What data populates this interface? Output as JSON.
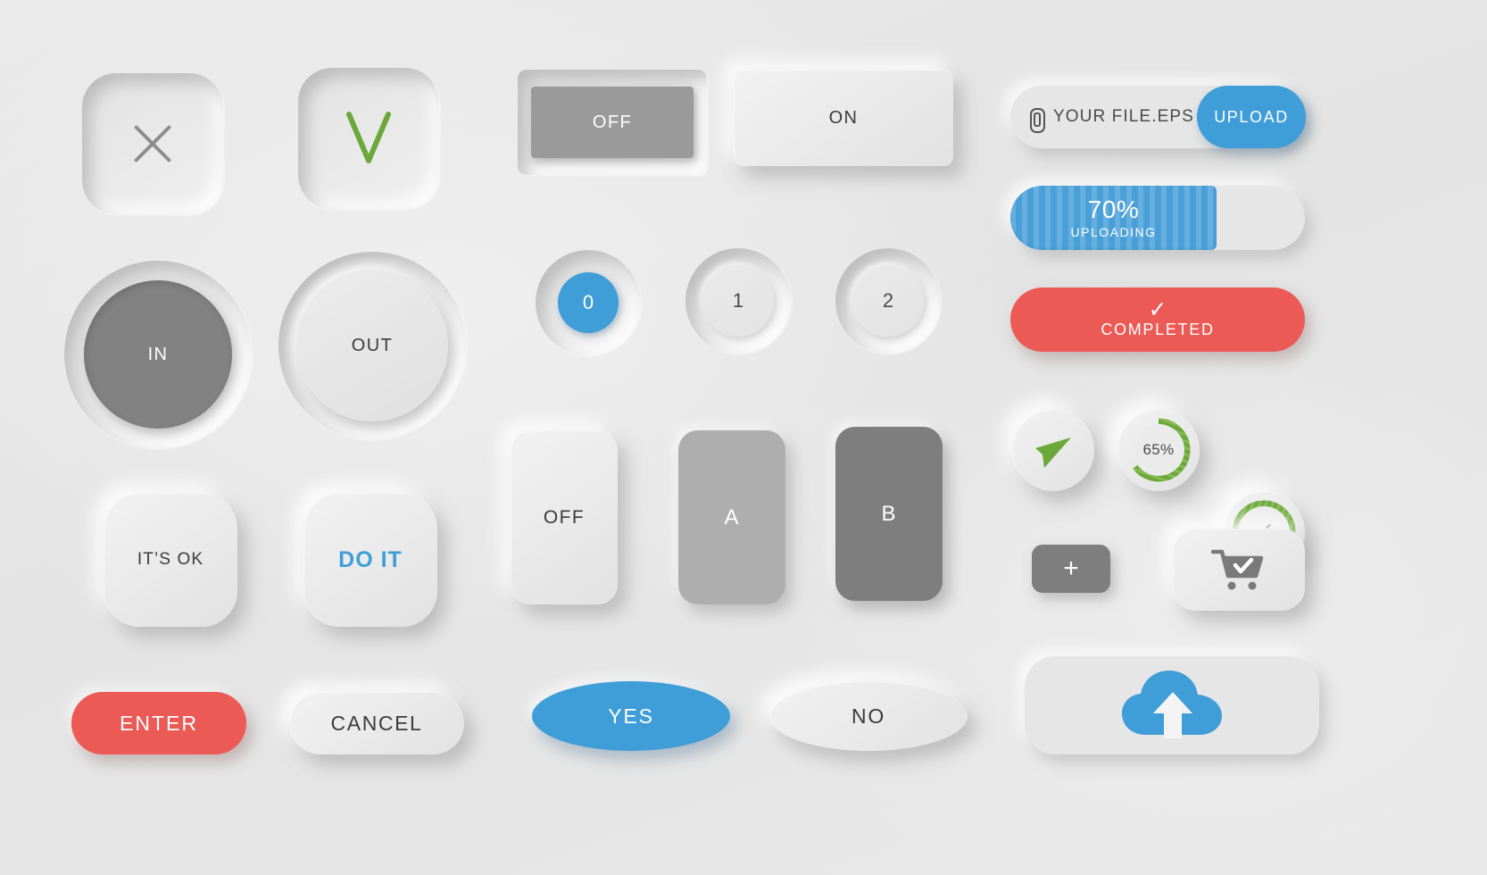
{
  "theme": {
    "background": "#e9e9e9",
    "accent_blue": "#3f9dd8",
    "accent_red": "#ec5a55",
    "accent_green": "#6aa83a",
    "dark_gray": "#7e7e7e",
    "mid_gray": "#aeaeae",
    "text_dark": "#3b3b3b",
    "text_light": "#ffffff"
  },
  "icon_buttons": {
    "close": {
      "icon": "close-x-icon",
      "state": "inset"
    },
    "check": {
      "icon": "check-v-icon",
      "glyph": "V",
      "color": "#6aa83a",
      "state": "inset"
    }
  },
  "toggles": {
    "off": {
      "label": "OFF",
      "state": "off"
    },
    "on": {
      "label": "ON",
      "state": "on"
    }
  },
  "upload": {
    "icon": "paperclip-icon",
    "filename": "YOUR FILE.EPS",
    "button_label": "UPLOAD"
  },
  "progress": {
    "percent": 70,
    "percent_label": "70%",
    "status": "UPLOADING"
  },
  "completed": {
    "icon": "check-icon",
    "check_glyph": "✓",
    "label": "COMPLETED"
  },
  "circle_buttons": {
    "in": {
      "label": "IN",
      "state": "selected"
    },
    "out": {
      "label": "OUT",
      "state": "default"
    }
  },
  "radio_group": {
    "options": [
      {
        "label": "0",
        "selected": true
      },
      {
        "label": "1",
        "selected": false
      },
      {
        "label": "2",
        "selected": false
      }
    ]
  },
  "square_buttons": {
    "ok": {
      "label": "IT’S OK"
    },
    "do_it": {
      "label": "DO IT"
    }
  },
  "vertical_tabs": [
    {
      "label": "OFF",
      "state": "light"
    },
    {
      "label": "A",
      "state": "mid"
    },
    {
      "label": "B",
      "state": "dark"
    }
  ],
  "status_circles": [
    {
      "name": "send",
      "icon": "send-plane-icon"
    },
    {
      "name": "progress",
      "icon": "ring-progress-icon",
      "percent": 65,
      "label": "65%"
    },
    {
      "name": "done",
      "icon": "ring-check-icon",
      "percent": 100,
      "check_glyph": "✓"
    }
  ],
  "small_actions": {
    "plus": {
      "label": "+",
      "icon": "plus-icon"
    },
    "cart": {
      "icon": "cart-check-icon"
    }
  },
  "pill_buttons": {
    "enter": {
      "label": "ENTER"
    },
    "cancel": {
      "label": "CANCEL"
    }
  },
  "ellipse_buttons": {
    "yes": {
      "label": "YES"
    },
    "no": {
      "label": "NO"
    }
  },
  "cloud_upload": {
    "icon": "cloud-upload-icon"
  }
}
